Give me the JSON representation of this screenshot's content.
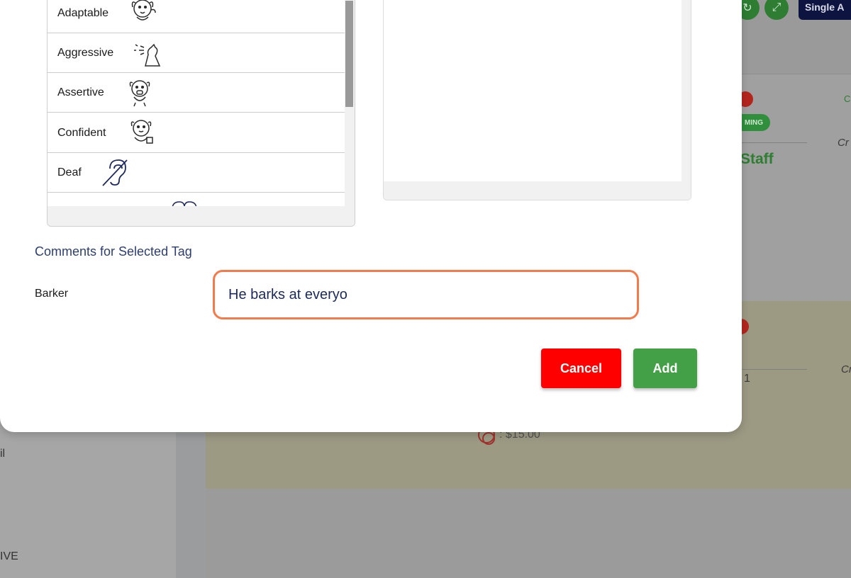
{
  "background": {
    "top_button_label": "Single A",
    "badge_text_partial": "MING",
    "staff_label": "Staff",
    "cr_label_1": "Cr",
    "cr_label_2": "Cr",
    "number_label": "1",
    "price": ": $15.00",
    "left_text_1": "il",
    "left_text_2": "IVE"
  },
  "tags": {
    "items": [
      {
        "label": "Adaptable",
        "icon": "adaptable-dog-icon"
      },
      {
        "label": "Aggressive",
        "icon": "aggressive-dog-icon"
      },
      {
        "label": "Assertive",
        "icon": "assertive-dog-icon"
      },
      {
        "label": "Confident",
        "icon": "confident-dog-icon"
      },
      {
        "label": "Deaf",
        "icon": "deaf-ear-icon"
      }
    ]
  },
  "comments": {
    "section_title": "Comments for Selected Tag",
    "tag_name": "Barker",
    "input_value": "He barks at everyo"
  },
  "actions": {
    "cancel_label": "Cancel",
    "add_label": "Add"
  },
  "colors": {
    "accent_focus": "#f27b4b",
    "cancel": "#ff0000",
    "add": "#43a047",
    "section_title": "#2d3e6e"
  }
}
